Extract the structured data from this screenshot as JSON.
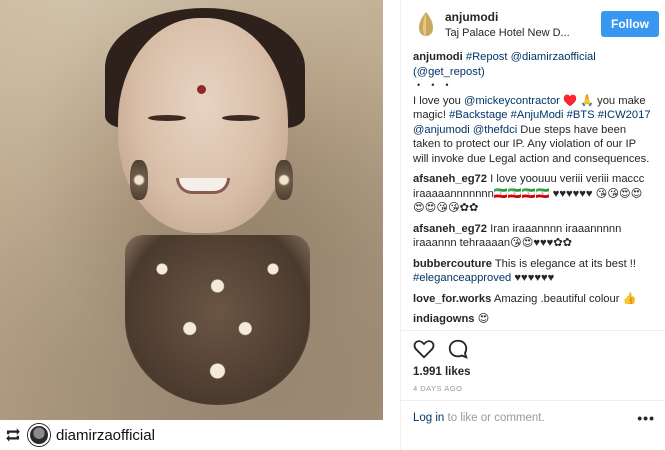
{
  "header": {
    "username": "anjumodi",
    "location": "Taj Palace Hotel New D...",
    "follow_label": "Follow"
  },
  "caption": {
    "user": "anjumodi",
    "repost_tag": "#Repost",
    "mention1": "@diamirzaofficial",
    "mention2": "(@get_repost)",
    "dots": "・・・",
    "l1": "I love you ",
    "mention3": "@mickeycontractor",
    "l2": " ♥️ 🙏 you make magic! ",
    "tags": "#Backstage #AnjuModi #BTS #ICW2017",
    "mention4": "@anjumodi",
    "mention5": "@thefdci",
    "l3": " Due steps have been taken to protect our IP. Any violation of our IP will invoke due Legal action and consequences."
  },
  "comments": [
    {
      "user": "afsaneh_eg72",
      "text": "I love yoouuu veriii veriii maccc iraaaaannnnnnn🇮🇷🇮🇷🇮🇷🇮🇷 ♥♥♥♥♥♥ 😘😘😍😍😍😍😘😘✿✿"
    },
    {
      "user": "afsaneh_eg72",
      "text": "Iran iraaannnn iraaannnnn iraaannn tehraaaan😘😍♥♥♥✿✿"
    },
    {
      "user": "bubbercouture",
      "text": "This is elegance at its best !! ",
      "tag": "#eleganceapproved",
      "tail": " ♥♥♥♥♥♥"
    },
    {
      "user": "love_for.works",
      "text": "Amazing .beautiful colour 👍"
    },
    {
      "user": "indiagowns",
      "text": "😍"
    }
  ],
  "likes": "1.991 likes",
  "time": "4 DAYS AGO",
  "login": {
    "link": "Log in",
    "rest": " to like or comment."
  },
  "more_label": "•••",
  "repost_bar": {
    "name": "diamirzaofficial"
  },
  "icons": [
    "heart-icon",
    "comment-icon",
    "repost-icon",
    "brand-logo-icon"
  ],
  "colors": {
    "follow": "#3897f0",
    "link": "#003569",
    "muted": "#999999"
  }
}
